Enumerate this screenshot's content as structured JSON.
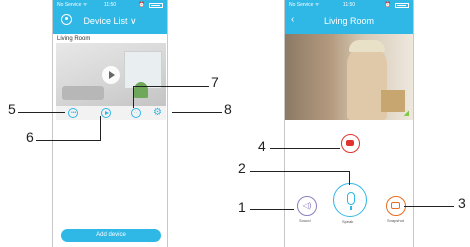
{
  "left_screen": {
    "status": {
      "carrier": "No Service ᯤ",
      "time": "11:50"
    },
    "title": "Device List ∨",
    "room_label": "Living Room",
    "add_device_label": "Add device"
  },
  "right_screen": {
    "status": {
      "carrier": "No Service ᯤ",
      "time": "11:50"
    },
    "back_glyph": "‹",
    "title": "Living Room",
    "sound_label": "Sound",
    "speak_label": "Speak",
    "snapshot_label": "Snapshot"
  },
  "callouts": {
    "n1": "1",
    "n2": "2",
    "n3": "3",
    "n4": "4",
    "n5": "5",
    "n6": "6",
    "n7": "7",
    "n8": "8"
  },
  "colors": {
    "accent": "#2fb7e6",
    "record": "#e0332f",
    "sound": "#8d7fbf",
    "snapshot": "#e86d1f"
  },
  "icons": [
    "avatar-icon",
    "play-icon",
    "message-icon",
    "playback-icon",
    "share-icon",
    "settings-icon",
    "back-icon",
    "record-icon",
    "sound-icon",
    "microphone-icon",
    "camera-icon",
    "wifi-icon"
  ]
}
